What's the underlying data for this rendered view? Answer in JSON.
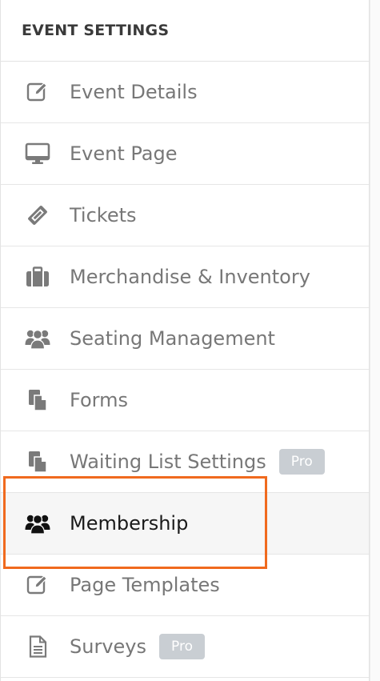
{
  "header": {
    "title": "EVENT SETTINGS"
  },
  "colors": {
    "highlight": "#f06a1e",
    "badge": "#c9ced3",
    "label": "#777777",
    "active_label": "#1a1a1a"
  },
  "items": [
    {
      "label": "Event Details",
      "icon": "edit-icon"
    },
    {
      "label": "Event Page",
      "icon": "monitor-icon"
    },
    {
      "label": "Tickets",
      "icon": "ticket-icon"
    },
    {
      "label": "Merchandise & Inventory",
      "icon": "briefcase-icon"
    },
    {
      "label": "Seating Management",
      "icon": "users-icon"
    },
    {
      "label": "Forms",
      "icon": "documents-icon"
    },
    {
      "label": "Waiting List Settings",
      "icon": "documents-icon",
      "badge": "Pro"
    },
    {
      "label": "Membership",
      "icon": "users-icon",
      "active": true
    },
    {
      "label": "Page Templates",
      "icon": "edit-icon"
    },
    {
      "label": "Surveys",
      "icon": "document-icon",
      "badge": "Pro"
    }
  ]
}
